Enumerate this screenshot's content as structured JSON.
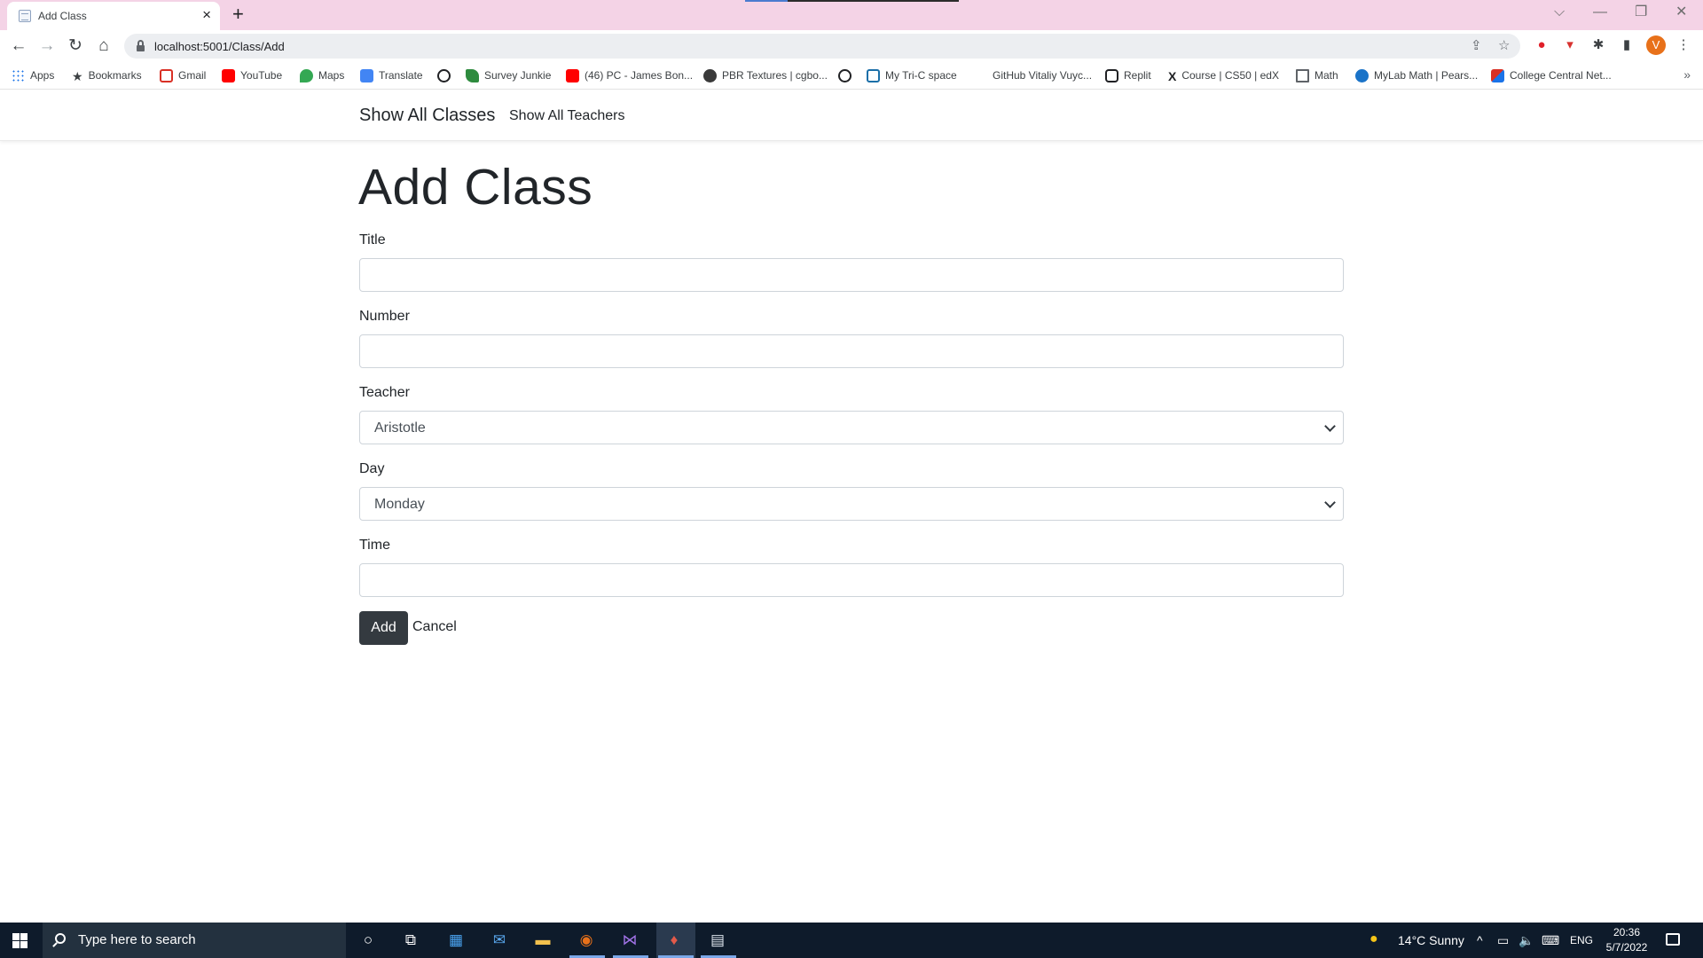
{
  "browser": {
    "tab_title": "Add Class",
    "url": "localhost:5001/Class/Add",
    "profile_initial": "V",
    "bookmarks": [
      "Apps",
      "Bookmarks",
      "Gmail",
      "YouTube",
      "Maps",
      "Translate",
      "Survey Junkie",
      "(46) PC - James Bon...",
      "PBR Textures | cgbo...",
      "My Tri-C space",
      "GitHub Vitaliy Vuyc...",
      "Replit",
      "Course | CS50 | edX",
      "Math",
      "MyLab Math | Pears...",
      "College Central Net..."
    ]
  },
  "nav": {
    "brand": "Show All Classes",
    "link_teachers": "Show All Teachers"
  },
  "page": {
    "title": "Add Class"
  },
  "form": {
    "title_label": "Title",
    "title_value": "",
    "number_label": "Number",
    "number_value": "",
    "teacher_label": "Teacher",
    "teacher_selected": "Aristotle",
    "day_label": "Day",
    "day_selected": "Monday",
    "time_label": "Time",
    "time_value": "",
    "add_label": "Add",
    "cancel_label": "Cancel"
  },
  "taskbar": {
    "search_placeholder": "Type here to search",
    "weather": "14°C  Sunny",
    "language": "ENG",
    "time": "20:36",
    "date": "5/7/2022"
  }
}
